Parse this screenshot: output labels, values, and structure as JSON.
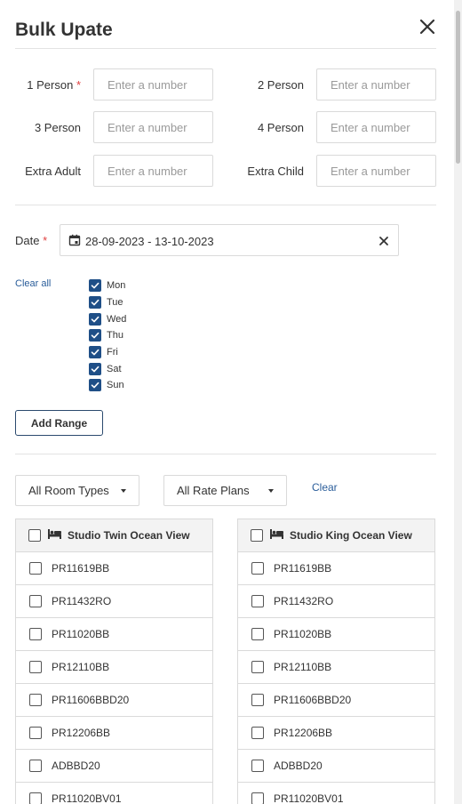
{
  "title": "Bulk Upate",
  "rates": {
    "one_person": {
      "label": "1 Person",
      "required_mark": "*",
      "placeholder": "Enter a number"
    },
    "two_person": {
      "label": "2 Person",
      "placeholder": "Enter a number"
    },
    "three_person": {
      "label": "3 Person",
      "placeholder": "Enter a number"
    },
    "four_person": {
      "label": "4 Person",
      "placeholder": "Enter a number"
    },
    "extra_adult": {
      "label": "Extra Adult",
      "placeholder": "Enter a number"
    },
    "extra_child": {
      "label": "Extra Child",
      "placeholder": "Enter a number"
    }
  },
  "date": {
    "label": "Date",
    "required_mark": "*",
    "value": "28-09-2023 - 13-10-2023"
  },
  "days": {
    "clear_all": "Clear all",
    "items": [
      {
        "label": "Mon",
        "checked": true
      },
      {
        "label": "Tue",
        "checked": true
      },
      {
        "label": "Wed",
        "checked": true
      },
      {
        "label": "Thu",
        "checked": true
      },
      {
        "label": "Fri",
        "checked": true
      },
      {
        "label": "Sat",
        "checked": true
      },
      {
        "label": "Sun",
        "checked": true
      }
    ]
  },
  "add_range_label": "Add Range",
  "filters": {
    "room_types": "All Room Types",
    "rate_plans": "All Rate Plans",
    "clear": "Clear"
  },
  "rooms": [
    {
      "name": "Studio Twin Ocean View",
      "rate_plans": [
        "PR11619BB",
        "PR11432RO",
        "PR11020BB",
        "PR12110BB",
        "PR11606BBD20",
        "PR12206BB",
        "ADBBD20",
        "PR11020BV01"
      ]
    },
    {
      "name": "Studio King Ocean View",
      "rate_plans": [
        "PR11619BB",
        "PR11432RO",
        "PR11020BB",
        "PR12110BB",
        "PR11606BBD20",
        "PR12206BB",
        "ADBBD20",
        "PR11020BV01"
      ]
    }
  ],
  "colors": {
    "accent": "#1f4f87",
    "link": "#2a5d9a",
    "required": "#e04040"
  }
}
